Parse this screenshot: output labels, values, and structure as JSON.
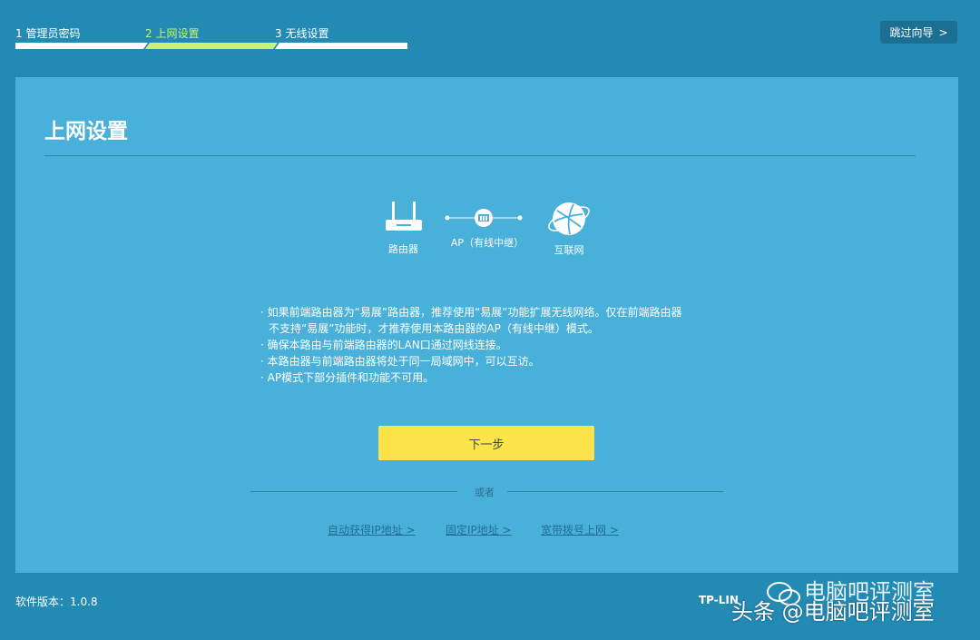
{
  "steps": [
    {
      "label": "1 管理员密码"
    },
    {
      "label": "2 上网设置"
    },
    {
      "label": "3 无线设置"
    }
  ],
  "skip_button": {
    "label": "跳过向导",
    "icon": "chevron-right-icon",
    "glyph": ">"
  },
  "card": {
    "title": "上网设置",
    "diagram": {
      "router_label": "路由器",
      "link_label": "AP（有线中继）",
      "internet_label": "互联网"
    },
    "notes": [
      "· 如果前端路由器为“易展”路由器，推荐使用“易展”功能扩展无线网络。仅在前端路由器",
      "不支持“易展”功能时，才推荐使用本路由器的AP（有线中继）模式。",
      "· 确保本路由与前端路由器的LAN口通过网线连接。",
      "· 本路由器与前端路由器将处于同一局域网中，可以互访。",
      "· AP模式下部分插件和功能不可用。"
    ],
    "next_button": "下一步",
    "or_text": "或者",
    "links": [
      "自动获得IP地址 >",
      "固定IP地址 >",
      "宽带拨号上网 >"
    ]
  },
  "footer": {
    "version": "软件版本：1.0.8",
    "brand_partial": "TP-LIN"
  },
  "watermark": {
    "line1": "电脑吧评测室",
    "line2": "头条 @电脑吧评测室"
  },
  "colors": {
    "background": "#238ab4",
    "card": "#49b0d9",
    "active_step": "#c7f56c",
    "next_button": "#fde44b"
  }
}
